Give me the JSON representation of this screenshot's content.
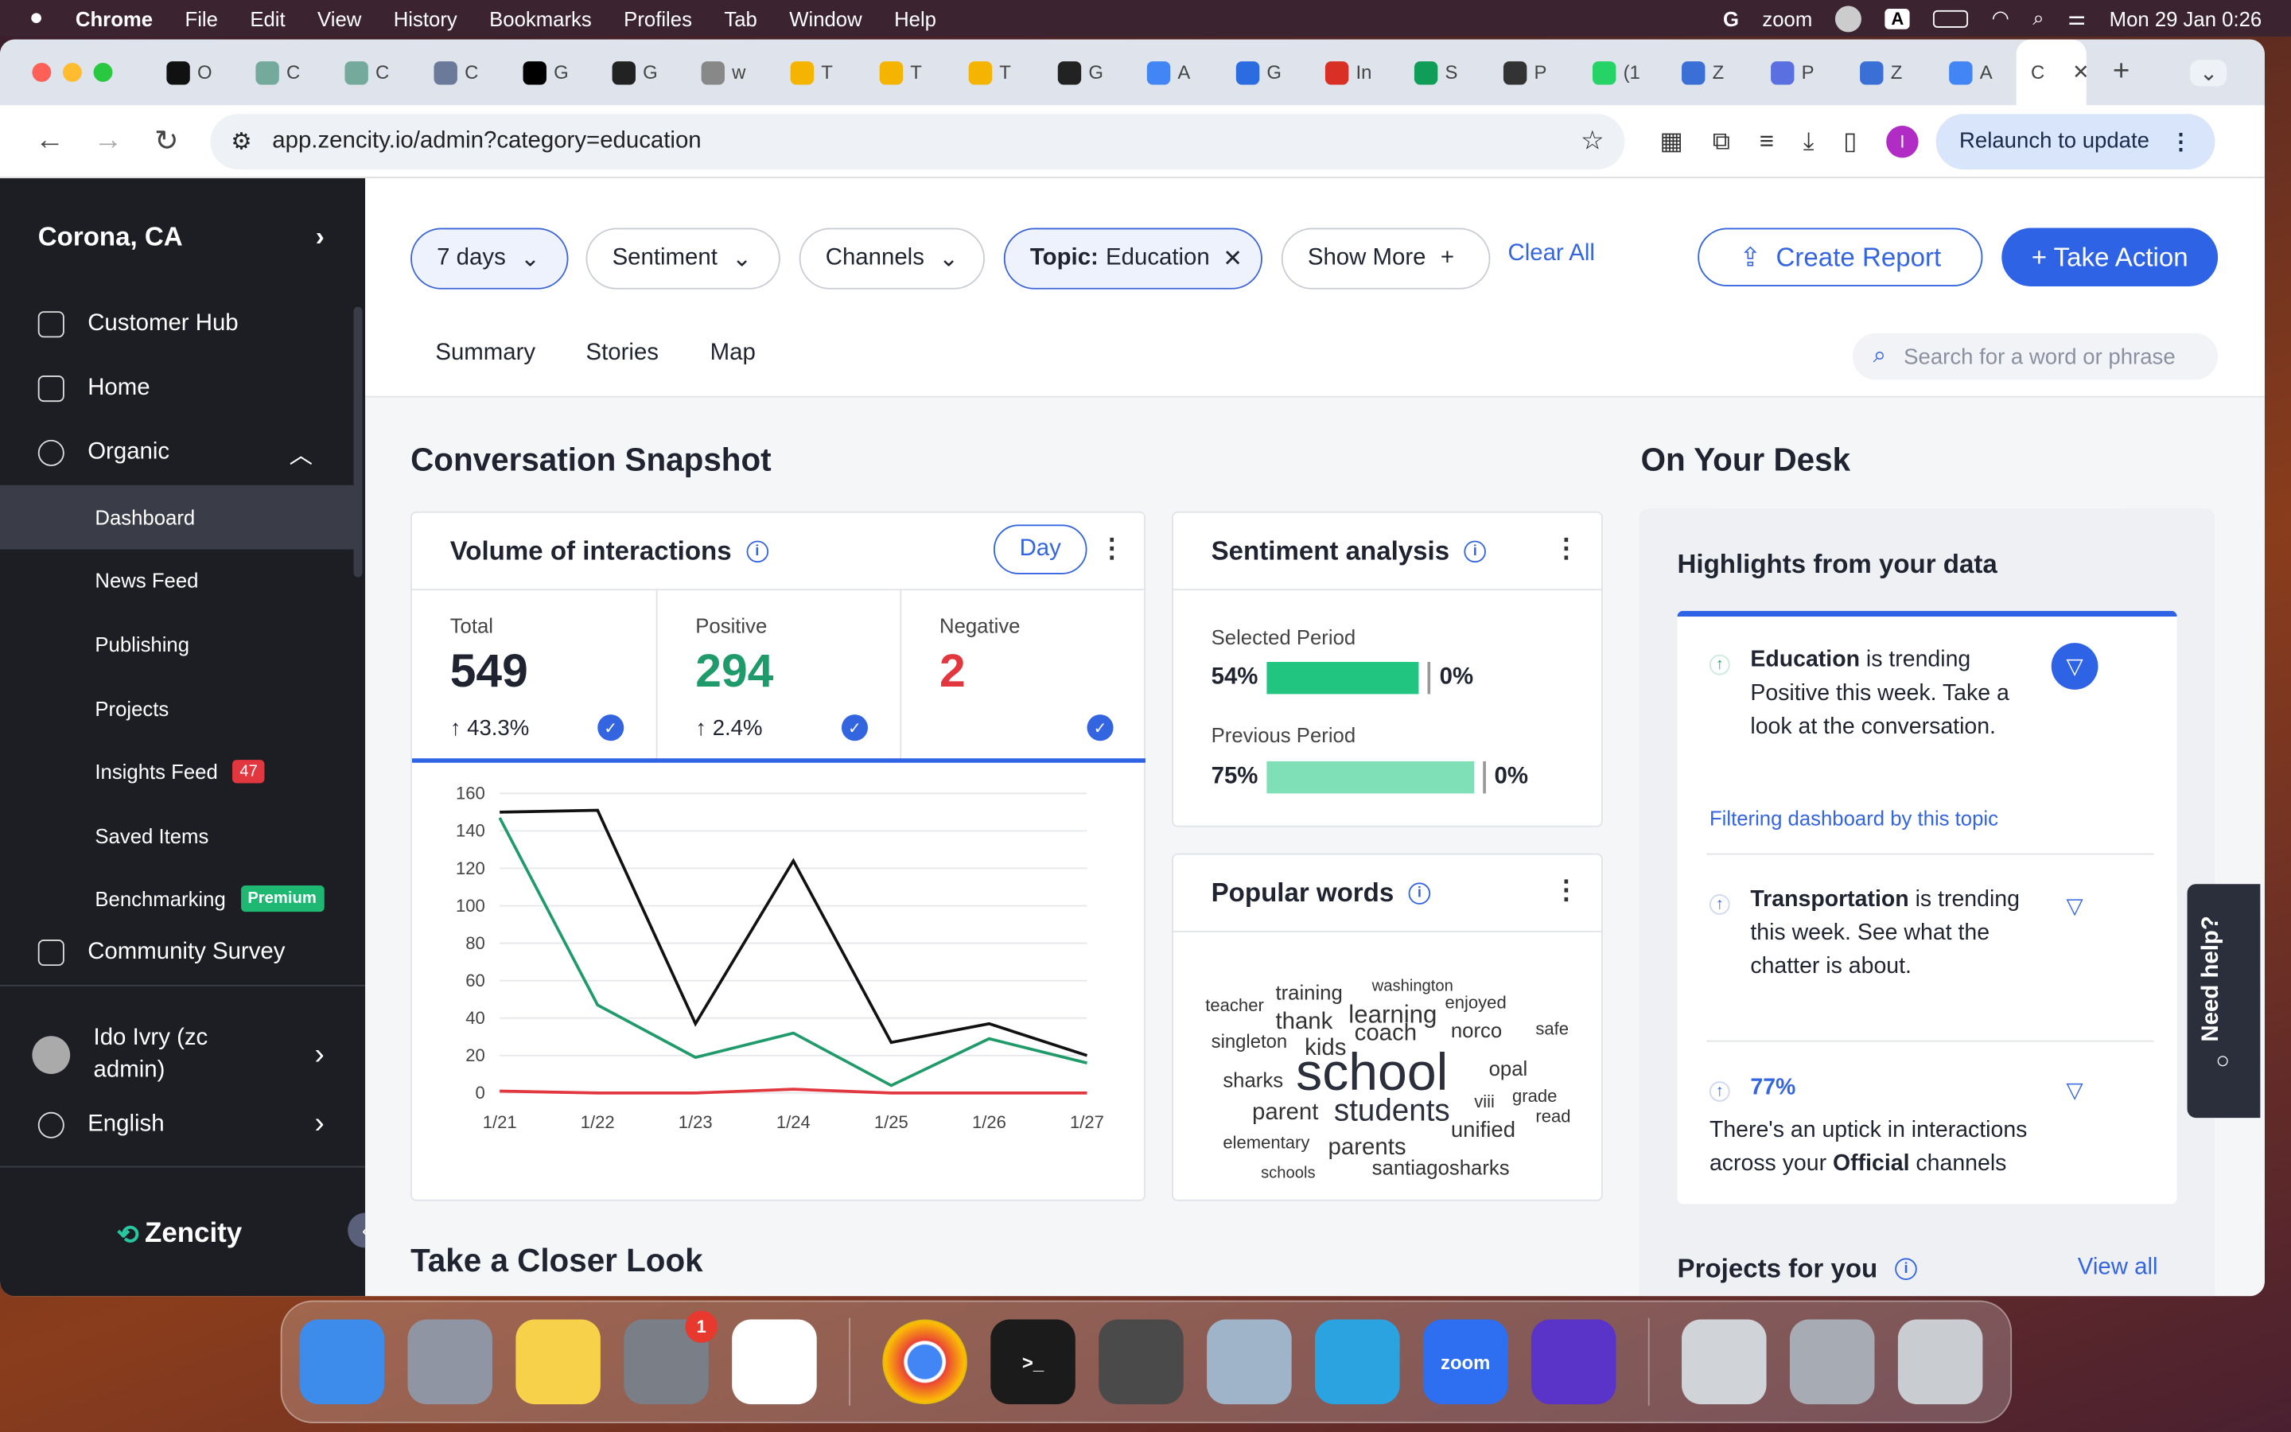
{
  "menubar": {
    "app": "Chrome",
    "items": [
      "File",
      "Edit",
      "View",
      "History",
      "Bookmarks",
      "Profiles",
      "Tab",
      "Window",
      "Help"
    ],
    "zoom": "zoom",
    "datetime": "Mon 29 Jan  0:26",
    "input_label": "A"
  },
  "tabs": [
    {
      "t": "O",
      "c": "#111"
    },
    {
      "t": "C",
      "c": "#74aa9c"
    },
    {
      "t": "C",
      "c": "#74aa9c"
    },
    {
      "t": "C",
      "c": "#6b7a99"
    },
    {
      "t": "G",
      "c": "#000"
    },
    {
      "t": "G",
      "c": "#222"
    },
    {
      "t": "w",
      "c": "#888"
    },
    {
      "t": "T",
      "c": "#f4b400"
    },
    {
      "t": "T",
      "c": "#f4b400"
    },
    {
      "t": "T",
      "c": "#f4b400"
    },
    {
      "t": "G",
      "c": "#222"
    },
    {
      "t": "A",
      "c": "#4285f4"
    },
    {
      "t": "G",
      "c": "#2b6de0"
    },
    {
      "t": "In",
      "c": "#d93025"
    },
    {
      "t": "S",
      "c": "#0f9d58"
    },
    {
      "t": "P",
      "c": "#333"
    },
    {
      "t": "(1",
      "c": "#25d366"
    },
    {
      "t": "Z",
      "c": "#3a6fd6"
    },
    {
      "t": "P",
      "c": "#5a6fe0"
    },
    {
      "t": "Z",
      "c": "#3a6fd6"
    },
    {
      "t": "A",
      "c": "#4285f4"
    }
  ],
  "active_tab": "C",
  "address": {
    "url": "app.zencity.io/admin?category=education",
    "relaunch": "Relaunch to update",
    "profile": "I"
  },
  "sidebar": {
    "city": "Corona, CA",
    "items": [
      "Customer Hub",
      "Home",
      "Organic"
    ],
    "subitems": [
      "Dashboard",
      "News Feed",
      "Publishing",
      "Projects",
      "Insights Feed",
      "Saved Items",
      "Benchmarking"
    ],
    "insights_badge": "47",
    "premium": "Premium",
    "community": "Community Survey",
    "user": "Ido Ivry (zc admin)",
    "language": "English",
    "brand": "Zencity"
  },
  "filters": {
    "days": "7 days",
    "sentiment": "Sentiment",
    "channels": "Channels",
    "topic_label": "Topic:",
    "topic_value": "Education",
    "show_more": "Show More",
    "clear_all": "Clear All"
  },
  "actions": {
    "create_report": "Create Report",
    "take_action": "+ Take Action"
  },
  "views": [
    "Summary",
    "Stories",
    "Map"
  ],
  "search": {
    "placeholder": "Search for a word or phrase"
  },
  "snapshot": {
    "title": "Conversation Snapshot",
    "volume": {
      "title": "Volume of interactions",
      "day": "Day",
      "total": {
        "label": "Total",
        "value": "549",
        "change": "↑ 43.3%"
      },
      "positive": {
        "label": "Positive",
        "value": "294",
        "change": "↑ 2.4%"
      },
      "negative": {
        "label": "Negative",
        "value": "2"
      }
    }
  },
  "chart_data": {
    "type": "line",
    "x": [
      "1/21",
      "1/22",
      "1/23",
      "1/24",
      "1/25",
      "1/26",
      "1/27"
    ],
    "ylim": [
      0,
      160
    ],
    "yticks": [
      0,
      20,
      40,
      60,
      80,
      100,
      120,
      140,
      160
    ],
    "series": [
      {
        "color": "#111111",
        "values": [
          150,
          151,
          37,
          124,
          27,
          37,
          20
        ]
      },
      {
        "color": "#1f9a6a",
        "values": [
          147,
          47,
          19,
          32,
          4,
          29,
          16
        ]
      },
      {
        "color": "#e2373f",
        "values": [
          1,
          0,
          0,
          2,
          0,
          0,
          0
        ]
      }
    ]
  },
  "sentiment": {
    "title": "Sentiment analysis",
    "selected_label": "Selected Period",
    "selected_pos": "54%",
    "selected_neg": "0%",
    "previous_label": "Previous Period",
    "previous_pos": "75%",
    "previous_neg": "0%",
    "selected_value": 54,
    "previous_value": 75,
    "bar_color": "#21c580",
    "bar_color_prev": "#7fe0b8"
  },
  "popular": {
    "title": "Popular words",
    "words": [
      "teacher",
      "training",
      "washington",
      "enjoyed",
      "thank",
      "learning",
      "singleton",
      "kids",
      "coach",
      "norco",
      "safe",
      "sharks",
      "school",
      "opal",
      "grade",
      "parent",
      "students",
      "viii",
      "read",
      "unified",
      "elementary",
      "parents",
      "schools",
      "santiagosharks"
    ]
  },
  "closer": {
    "title": "Take a Closer Look"
  },
  "desk": {
    "title": "On Your Desk",
    "highlights": "Highlights from your data",
    "h1_bold": "Education",
    "h1_rest": " is trending Positive this week. Take a look at the conversation.",
    "h1_link": "Filtering dashboard by this topic",
    "h2_bold": "Transportation",
    "h2_rest": " is trending this week. See what the chatter is about.",
    "h3_pct": "77%",
    "h3_a": "There's an uptick in interactions across your ",
    "h3_bold": "Official",
    "h3_b": " channels",
    "projects": "Projects for you",
    "view_all": "View all"
  },
  "needhelp": "Need help?",
  "dock": [
    {
      "c": "#3d8bea"
    },
    {
      "c": "#8f95a3"
    },
    {
      "c": "#f7d14a"
    },
    {
      "c": "#7a7e87",
      "badge": "1"
    },
    {
      "c": "#ffffff"
    },
    {
      "c": "#ffffff"
    },
    {
      "c": "#1b1b1b"
    },
    {
      "c": "#4a4a4a"
    },
    {
      "c": "#9fb4c8"
    },
    {
      "c": "#2aa3e0"
    },
    {
      "c": "#2d6ff0"
    },
    {
      "c": "#5a34c9"
    },
    {
      "c": "#d0d3d8"
    },
    {
      "c": "#a7abb3"
    },
    {
      "c": "#c9ccd1"
    }
  ],
  "dock_labels": {
    "zoom": "zoom",
    "terminal": ">_"
  }
}
